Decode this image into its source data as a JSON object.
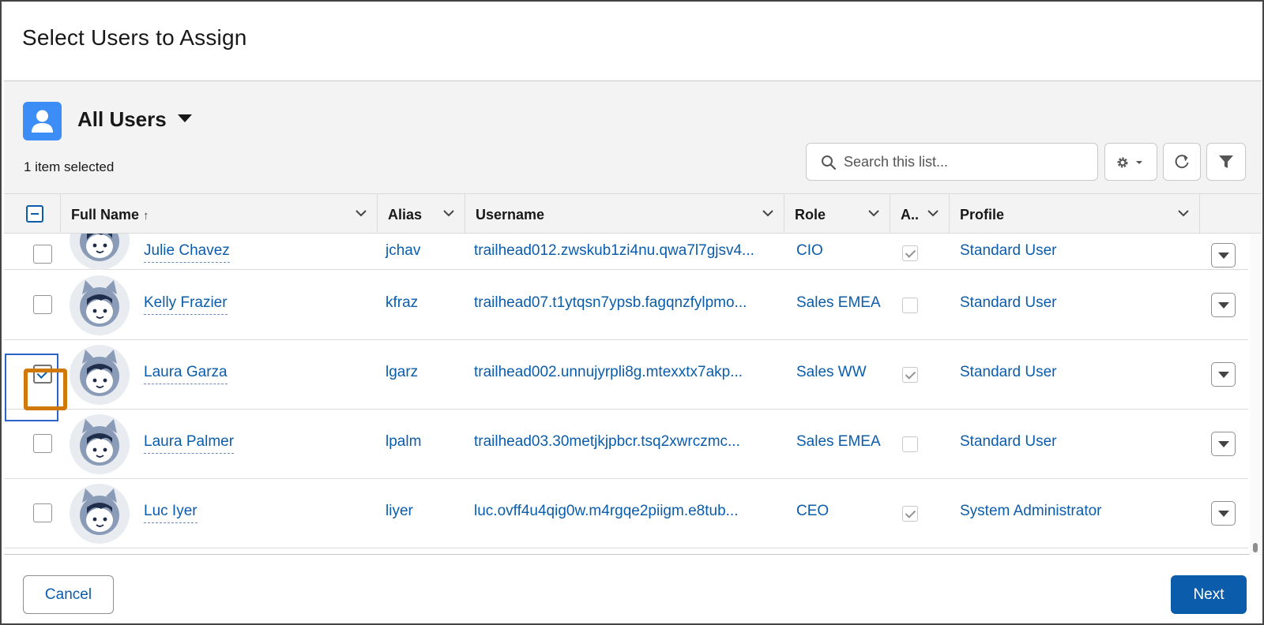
{
  "modal": {
    "title": "Select Users to Assign"
  },
  "list_view": {
    "name": "All Users",
    "selected_count": "1 item selected",
    "search_placeholder": "Search this list...",
    "icons": {
      "object": "user-icon",
      "search": "search-icon",
      "settings": "gear-icon",
      "refresh": "refresh-icon",
      "filter": "filter-icon"
    },
    "colors": {
      "object_icon": "#3c8df6",
      "link": "#0b5cab",
      "highlight": "#d1780b"
    }
  },
  "columns": [
    {
      "label": "Full Name",
      "sort": "↑"
    },
    {
      "label": "Alias"
    },
    {
      "label": "Username"
    },
    {
      "label": "Role"
    },
    {
      "label": "A.."
    },
    {
      "label": "Profile"
    }
  ],
  "rows": [
    {
      "name": "Julie Chavez",
      "alias": "jchav",
      "username": "trailhead012.zwskub1zi4nu.qwa7l7gjsv4...",
      "role": "CIO",
      "active": true,
      "profile": "Standard User",
      "selected": false
    },
    {
      "name": "Kelly Frazier",
      "alias": "kfraz",
      "username": "trailhead07.t1ytqsn7ypsb.fagqnzfylpmo...",
      "role": "Sales EMEA",
      "active": false,
      "profile": "Standard User",
      "selected": false
    },
    {
      "name": "Laura Garza",
      "alias": "lgarz",
      "username": "trailhead002.unnujyrpli8g.mtexxtx7akp...",
      "role": "Sales WW",
      "active": true,
      "profile": "Standard User",
      "selected": true
    },
    {
      "name": "Laura Palmer",
      "alias": "lpalm",
      "username": "trailhead03.30metjkjpbcr.tsq2xwrczmc...",
      "role": "Sales EMEA",
      "active": false,
      "profile": "Standard User",
      "selected": false
    },
    {
      "name": "Luc Iyer",
      "alias": "liyer",
      "username": "luc.ovff4u4qig0w.m4rgqe2piigm.e8tub...",
      "role": "CEO",
      "active": true,
      "profile": "System Administrator",
      "selected": false
    }
  ],
  "footer": {
    "cancel_label": "Cancel",
    "next_label": "Next"
  }
}
